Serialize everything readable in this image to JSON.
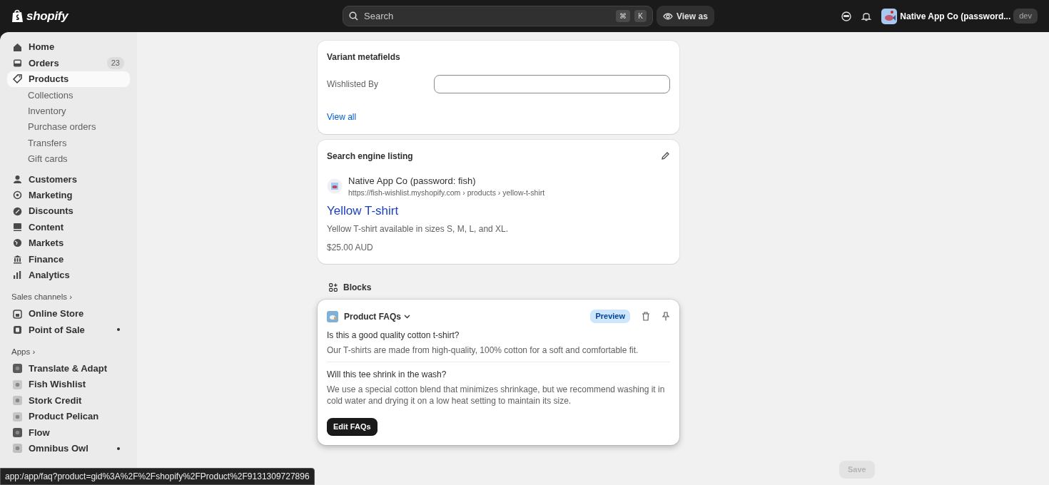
{
  "topbar": {
    "logo": "shopify",
    "search": {
      "placeholder": "Search",
      "keys": [
        "⌘",
        "K"
      ]
    },
    "view_as": "View as",
    "store": {
      "name": "Native App Co (password...",
      "badge": "dev"
    }
  },
  "sidebar": {
    "items": [
      {
        "kind": "main",
        "label": "Home",
        "selected": false
      },
      {
        "kind": "main",
        "label": "Orders",
        "selected": false,
        "count": "23"
      },
      {
        "kind": "main",
        "label": "Products",
        "selected": true
      },
      {
        "kind": "sub",
        "label": "Collections",
        "selected": false
      },
      {
        "kind": "sub",
        "label": "Inventory",
        "selected": false
      },
      {
        "kind": "sub",
        "label": "Purchase orders",
        "selected": false
      },
      {
        "kind": "sub",
        "label": "Transfers",
        "selected": false
      },
      {
        "kind": "sub",
        "label": "Gift cards",
        "selected": false
      },
      {
        "kind": "main",
        "label": "Customers",
        "selected": false
      },
      {
        "kind": "main",
        "label": "Marketing",
        "selected": false
      },
      {
        "kind": "main",
        "label": "Discounts",
        "selected": false
      },
      {
        "kind": "main",
        "label": "Content",
        "selected": false
      },
      {
        "kind": "main",
        "label": "Markets",
        "selected": false
      },
      {
        "kind": "main",
        "label": "Finance",
        "selected": false
      },
      {
        "kind": "main",
        "label": "Analytics",
        "selected": false
      },
      {
        "kind": "section",
        "label": "Sales channels ›"
      },
      {
        "kind": "main",
        "label": "Online Store",
        "selected": false
      },
      {
        "kind": "main",
        "label": "Point of Sale",
        "selected": false,
        "notification": true
      },
      {
        "kind": "section",
        "label": "Apps ›"
      },
      {
        "kind": "app",
        "label": "Translate & Adapt",
        "selected": false
      },
      {
        "kind": "app",
        "label": "Fish Wishlist",
        "selected": false
      },
      {
        "kind": "app",
        "label": "Stork Credit",
        "selected": false
      },
      {
        "kind": "app",
        "label": "Product Pelican",
        "selected": false
      },
      {
        "kind": "app",
        "label": "Flow",
        "selected": false
      },
      {
        "kind": "app",
        "label": "Omnibus Owl",
        "selected": false,
        "notification": true
      }
    ]
  },
  "metafields": {
    "title": "Variant metafields",
    "fields": [
      {
        "label": "Wishlisted By"
      }
    ],
    "link": "View all"
  },
  "seo": {
    "title": "Search engine listing",
    "store_name": "Native App Co (password: fish)",
    "url": "https://fish-wishlist.myshopify.com › products › yellow-t-shirt",
    "page_title": "Yellow T-shirt",
    "description": "Yellow T-shirt available in sizes S, M, L, and XL.",
    "price": "$25.00 AUD"
  },
  "blocks": {
    "heading": "Blocks",
    "block": {
      "name": "Product FAQs",
      "badge": "Preview",
      "faqs": [
        {
          "question": "Is this a good quality cotton t-shirt?",
          "answer": "Our T-shirts are made from high-quality, 100% cotton for a soft and comfortable fit."
        },
        {
          "question": "Will this tee shrink in the wash?",
          "answer": "We use a special cotton blend that minimizes shrinkage, but we recommend washing it in cold water and drying it on a low heat setting to maintain its size."
        }
      ],
      "button": "Edit FAQs"
    }
  },
  "save": {
    "label": "Save",
    "disabled": true
  },
  "status_url": "app:/app/faq?product=gid%3A%2F%2Fshopify%2FProduct%2F9131309727896"
}
